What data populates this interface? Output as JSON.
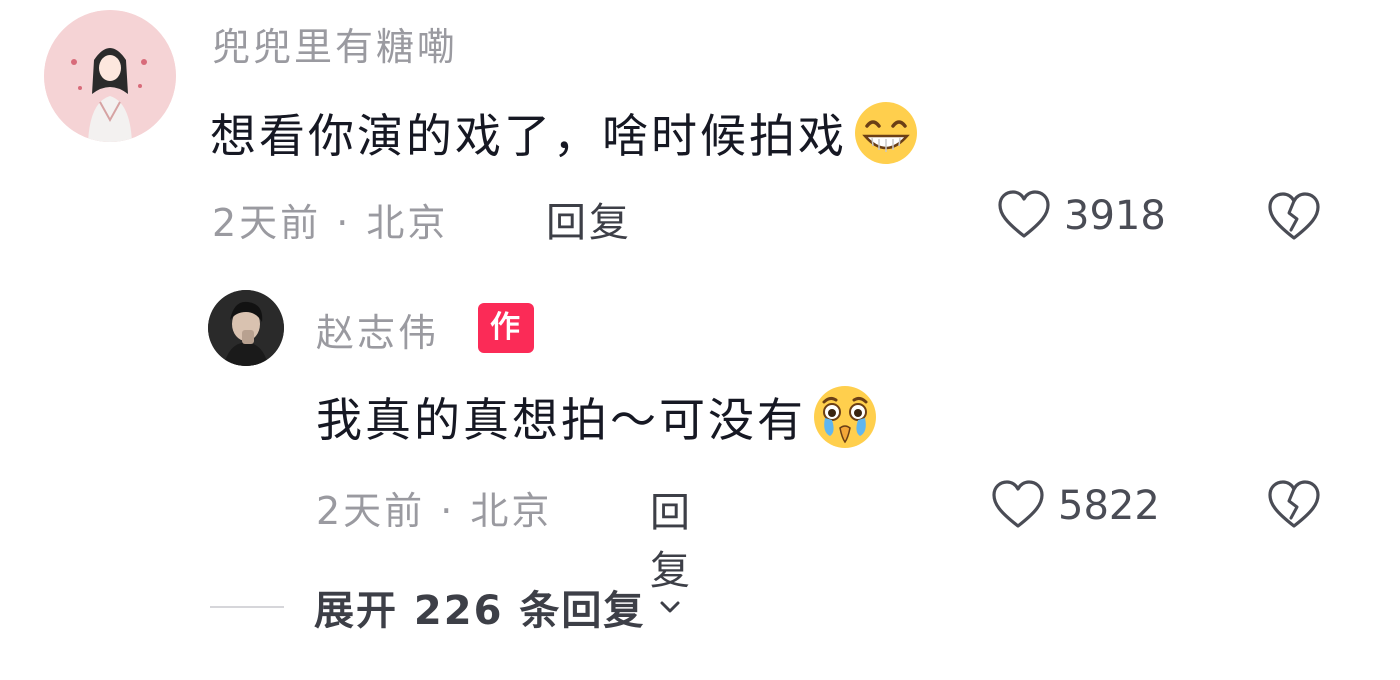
{
  "comment": {
    "username": "兜兜里有糖嘞",
    "text": "想看你演的戏了，啥时候拍戏",
    "text_emoji": "grinning-face-emoji",
    "time_location": "2天前 · 北京",
    "reply_label": "回复",
    "likes": "3918"
  },
  "reply": {
    "username": "赵志伟",
    "badge": "作者",
    "text": "我真的真想拍～可没有",
    "text_emoji": "crying-face-emoji",
    "time_location": "2天前 · 北京",
    "reply_label": "回复",
    "likes": "5822"
  },
  "expand": {
    "label": "展开 226 条回复"
  },
  "colors": {
    "badge": "#fb2b57",
    "primary_text": "#161823",
    "secondary_text": "#9a9aa0"
  }
}
